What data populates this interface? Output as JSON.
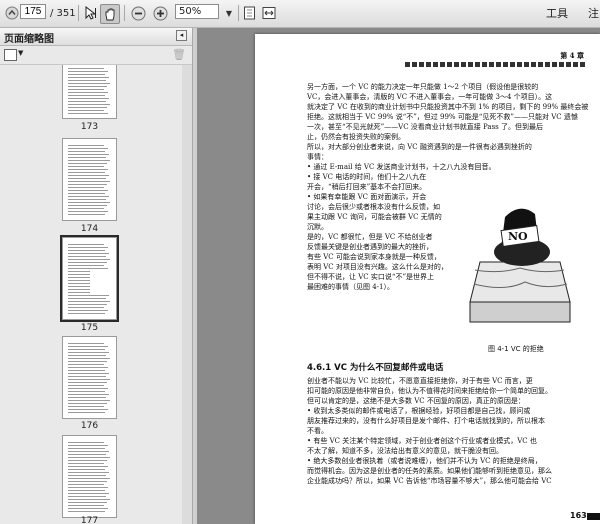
{
  "toolbar": {
    "page_current": "175",
    "page_total": "/ 351",
    "zoom": "50%",
    "tools_label": "工具",
    "comment_label": "注"
  },
  "sidebar": {
    "title": "页面缩略图",
    "thumbs": [
      {
        "label": "173"
      },
      {
        "label": "174"
      },
      {
        "label": "175"
      },
      {
        "label": "176"
      },
      {
        "label": "177"
      }
    ],
    "selected_index": 2
  },
  "page": {
    "chapter": "第 4 章",
    "lines": [
      "另一方面，一个 VC 的能力决定一年只能做 1～2 个项目（假设他是很较的",
      "VC，会进入董事会，清版的 VC 不进入董事会，一年可能做 3～4 个项目）。这",
      "就决定了 VC 在收到的商业计划书中只能投资其中不到 1% 的项目，剩下的 99% 最终会被",
      "拒绝。这就相当于 VC 99% 说“不”，但过 99% 可能是“见死不救”——只能对 VC 遗憾",
      "一次，甚至“不见光就死”——VC 没看商业计划书就直接 Pass 了。但到最后",
      "止，仍然会有投资失败的案例。",
      "所以，对大部分创业者来说，向 VC 融资遇到的是一件很有必遇到挫折的",
      "事情：",
      "• 通过 E-mail 给 VC 发送商业计划书，十之八九没有回音。",
      "• 接 VC 电话的时间，他们十之八九在",
      "开会，“稍后打回来”基本不会打回来。",
      "• 如果有幸能跟 VC 面对面演示，开会",
      "讨论，会后很少或者根本没有什么反馈，如",
      "果主动跟 VC 询问，可能会被群 VC 无情的",
      "沉默。",
      "是的，VC 都很忙，但是 VC 不给创业者",
      "反馈最关键是创业者遇到的最大的挫折，",
      "有些 VC 可能会说到家本身就是一种反馈，",
      "表明 VC 对项目没有兴趣。这么什么是对的，",
      "但不得不说，让 VC 实口说“不”是世界上",
      "最困难的事情（见图 4-1）。"
    ],
    "figure_caption": "图 4-1   VC 的拒绝",
    "figure_text": "NO",
    "section_title": "4.6.1   VC 为什么不回复邮件或电话",
    "lines2": [
      "创业者不能以为 VC 比较忙，不愿意直接拒绝你，对于有些 VC 而言，更",
      "扣可能的原因是他非常自负，他认为不值得花时间来拒绝给你一个简单的回复。",
      "但可以肯定的是，这绝不是大多数 VC 不回复的原因，真正的原因是：",
      "• 收到太多类似的邮件或电话了，根据经验，好项目都是自己找，顾问或",
      "朋友推荐过来的，没有什么好项目是发个邮件、打个电话就找到的，所以根本",
      "不看。",
      "• 有些 VC 关注某个特定领域，对于创业者创这个行业或者业模式，VC 也",
      "不太了解，知道不多，没法给出有意义的意见，就干脆没有回。",
      "• 绝大多数创业者很执着（或者说难缠），他们并不认为 VC 的拒绝是终局，",
      "而觉得机会。因为这是创业者的任务的素质。如果他们能够听到拒绝意见，那么",
      "企业能成功吗？所以，如果 VC 告诉他“市场容量不够大”，那么他可能会给 VC"
    ],
    "page_number": "163"
  }
}
